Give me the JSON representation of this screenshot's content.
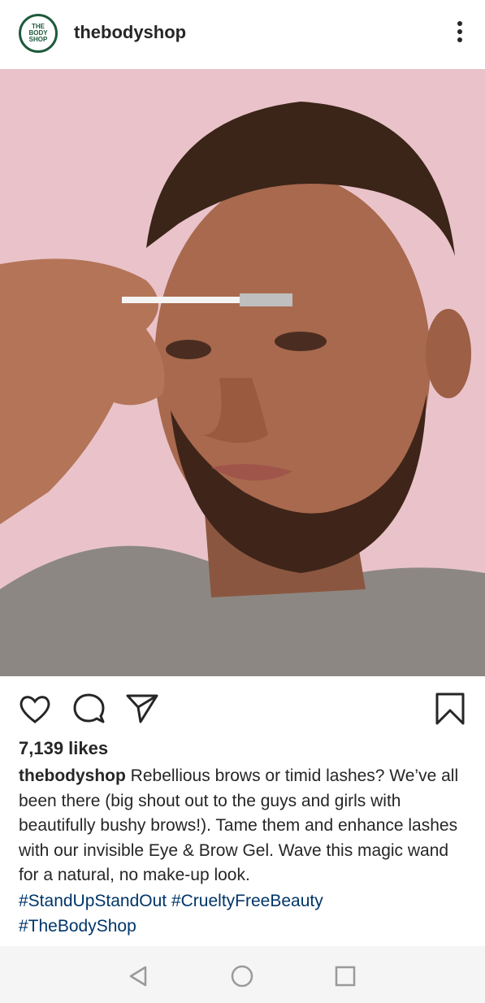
{
  "header": {
    "username": "thebodyshop",
    "avatar_text": "THE\nBODY\nSHOP",
    "more_icon": "more-vertical-icon"
  },
  "post": {
    "image_alt": "man with freckles applying clear brow gel",
    "likes": "7,139 likes",
    "caption_user": "thebodyshop",
    "caption_text": "Rebellious brows or timid lashes? We’ve all been there (big shout out to the guys and girls with beautifully bushy brows!). Tame them and enhance lashes with our invisible Eye & Brow Gel. Wave this magic wand for a natural, no make-up look.",
    "hashtags_line1": "#StandUpStandOut #CrueltyFreeBeauty",
    "hashtags_line2": "#TheBodyShop"
  },
  "icons": {
    "like": "heart-icon",
    "comment": "comment-icon",
    "share": "send-icon",
    "save": "bookmark-icon"
  },
  "colors": {
    "brand_green": "#1f5a3d",
    "hashtag_blue": "#1c4e8b",
    "photo_bg": "#e8c2c8"
  }
}
